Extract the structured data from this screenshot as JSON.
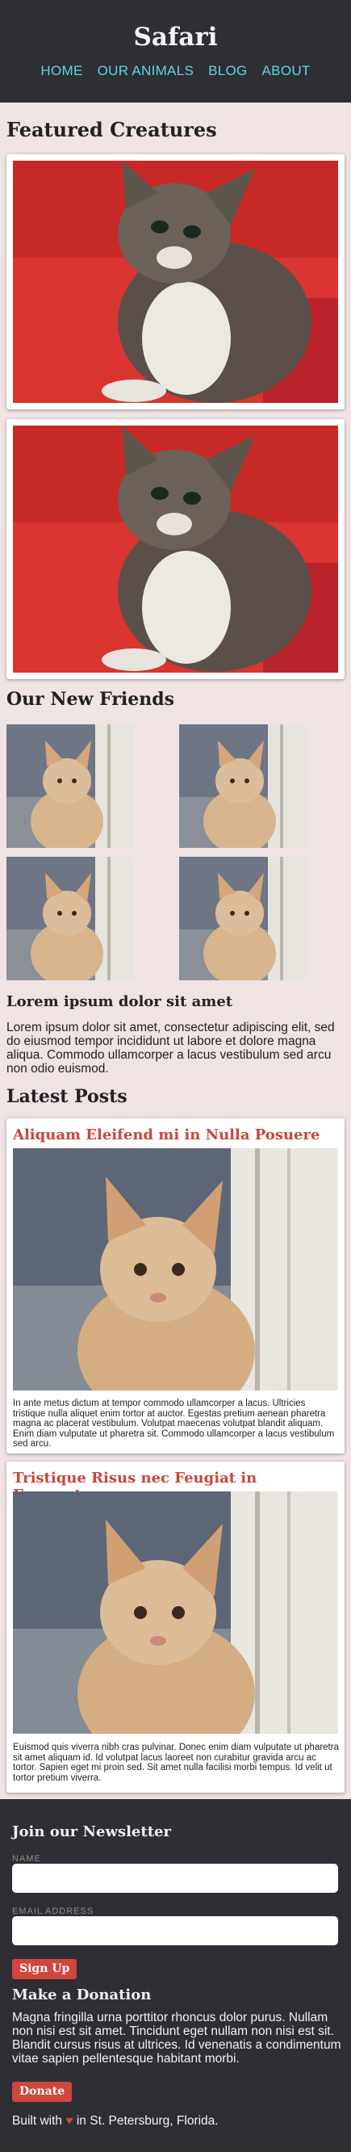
{
  "header": {
    "brand": "Safari",
    "nav": [
      "HOME",
      "OUR ANIMALS",
      "BLOG",
      "ABOUT"
    ]
  },
  "featured": {
    "title": "Featured Creatures"
  },
  "friends": {
    "title": "Our New Friends"
  },
  "lorem": {
    "title": "Lorem ipsum dolor sit amet",
    "text": "Lorem ipsum dolor sit amet, consectetur adipiscing elit, sed do eiusmod tempor incididunt ut labore et dolore magna aliqua. Commodo ullamcorper a lacus vestibulum sed arcu non odio euismod."
  },
  "posts": {
    "title": "Latest Posts",
    "items": [
      {
        "title": "Aliquam Eleifend mi in Nulla Posuere",
        "text": "In ante metus dictum at tempor commodo ullamcorper a lacus. Ultricies tristique nulla aliquet enim tortor at auctor. Egestas pretium aenean pharetra magna ac placerat vestibulum. Volutpat maecenas volutpat blandit aliquam. Enim diam vulputate ut pharetra sit. Commodo ullamcorper a lacus vestibulum sed arcu."
      },
      {
        "title": "Tristique Risus nec Feugiat in Fermentum",
        "text": "Euismod quis viverra nibh cras pulvinar. Donec enim diam vulputate ut pharetra sit amet aliquam id. Id volutpat lacus laoreet non curabitur gravida arcu ac tortor. Sapien eget mi proin sed. Sit amet nulla facilisi morbi tempus. Id velit ut tortor pretium viverra."
      }
    ]
  },
  "newsletter": {
    "title": "Join our Newsletter",
    "name_label": "NAME",
    "email_label": "EMAIL ADDRESS",
    "button": "Sign Up"
  },
  "donation": {
    "title": "Make a Donation",
    "text": "Magna fringilla urna porttitor rhoncus dolor purus. Nullam non nisi est sit amet. Tincidunt eget nullam non nisi est sit. Blandit cursus risus at ultrices. Id venenatis a condimentum vitae sapien pellentesque habitant morbi.",
    "button": "Donate"
  },
  "footer": {
    "built_prefix": "Built with",
    "built_suffix": "in St. Petersburg, Florida."
  },
  "colors": {
    "header_bg": "#2d2f35",
    "nav": "#63d3dd",
    "accent": "#d0463c",
    "page_bg": "#efe3e4"
  }
}
